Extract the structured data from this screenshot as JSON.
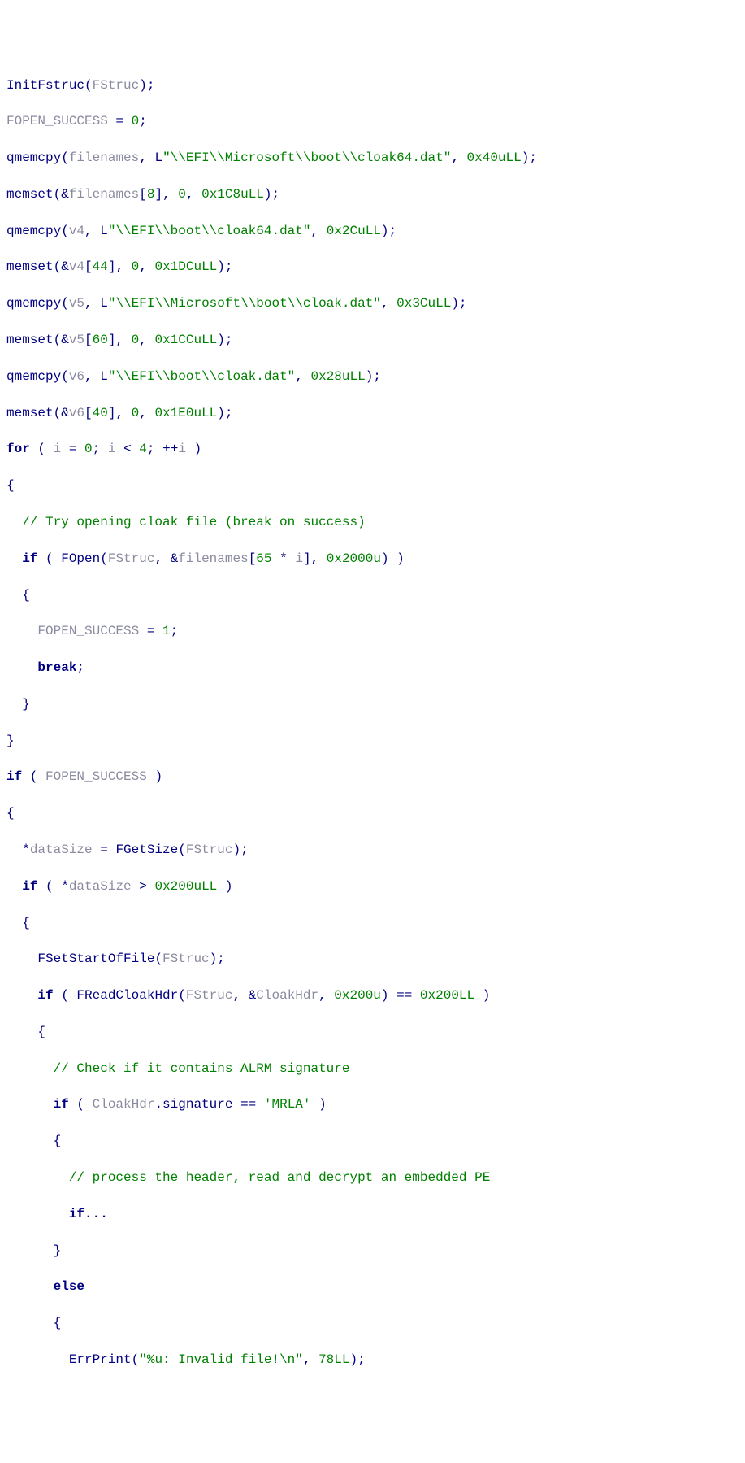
{
  "code": {
    "l1": {
      "fn": "InitFstruc",
      "arg": "FStruc"
    },
    "l2": {
      "lhs": "FOPEN_SUCCESS",
      "rhs": "0"
    },
    "l3": {
      "fn": "qmemcpy",
      "a1": "filenames",
      "prefix": "L",
      "str": "\"\\\\EFI\\\\Microsoft\\\\boot\\\\cloak64.dat\"",
      "a3": "0x40uLL"
    },
    "l4": {
      "fn": "memset",
      "pre": "&",
      "a1": "filenames",
      "idx": "8",
      "a2": "0",
      "a3": "0x1C8uLL"
    },
    "l5": {
      "fn": "qmemcpy",
      "a1": "v4",
      "prefix": "L",
      "str": "\"\\\\EFI\\\\boot\\\\cloak64.dat\"",
      "a3": "0x2CuLL"
    },
    "l6": {
      "fn": "memset",
      "pre": "&",
      "a1": "v4",
      "idx": "44",
      "a2": "0",
      "a3": "0x1DCuLL"
    },
    "l7": {
      "fn": "qmemcpy",
      "a1": "v5",
      "prefix": "L",
      "str": "\"\\\\EFI\\\\Microsoft\\\\boot\\\\cloak.dat\"",
      "a3": "0x3CuLL"
    },
    "l8": {
      "fn": "memset",
      "pre": "&",
      "a1": "v5",
      "idx": "60",
      "a2": "0",
      "a3": "0x1CCuLL"
    },
    "l9": {
      "fn": "qmemcpy",
      "a1": "v6",
      "prefix": "L",
      "str": "\"\\\\EFI\\\\boot\\\\cloak.dat\"",
      "a3": "0x28uLL"
    },
    "l10": {
      "fn": "memset",
      "pre": "&",
      "a1": "v6",
      "idx": "40",
      "a2": "0",
      "a3": "0x1E0uLL"
    },
    "l11": {
      "kw": "for",
      "init_l": "i",
      "init_r": "0",
      "cond_l": "i",
      "cond_op": "<",
      "cond_r": "4",
      "iter": "++",
      "iter_v": "i"
    },
    "l12": "{",
    "l13": "// Try opening cloak file (break on success)",
    "l14": {
      "kw": "if",
      "fn": "FOpen",
      "a1": "FStruc",
      "pre": "&",
      "a2": "filenames",
      "idx_l": "65",
      "idx_op": "*",
      "idx_r": "i",
      "a3": "0x2000u"
    },
    "l15": "{",
    "l16": {
      "lhs": "FOPEN_SUCCESS",
      "rhs": "1"
    },
    "l17": "break",
    "l18": "}",
    "l19": "}",
    "l20": {
      "kw": "if",
      "cond": "FOPEN_SUCCESS"
    },
    "l21": "{",
    "l22": {
      "lhs_pre": "*",
      "lhs": "dataSize",
      "fn": "FGetSize",
      "a1": "FStruc"
    },
    "l23": {
      "kw": "if",
      "lhs_pre": "*",
      "lhs": "dataSize",
      "op": ">",
      "rhs": "0x200uLL"
    },
    "l24": "{",
    "l25": {
      "fn": "FSetStartOfFile",
      "a1": "FStruc"
    },
    "l26": {
      "kw": "if",
      "fn": "FReadCloakHdr",
      "a1": "FStruc",
      "pre": "&",
      "a2": "CloakHdr",
      "a3": "0x200u",
      "op": "==",
      "rhs": "0x200LL"
    },
    "l27": "{",
    "l28": "// Check if it contains ALRM signature",
    "l29": {
      "kw": "if",
      "obj": "CloakHdr",
      "mem": "signature",
      "op": "==",
      "rhs": "'MRLA'"
    },
    "l30": "{",
    "l31": "// process the header, read and decrypt an embedded PE",
    "l32": "if...",
    "l33": "}",
    "l34": "else",
    "l35": "{",
    "l36": {
      "fn": "ErrPrint",
      "str": "\"%u: Invalid file!\\n\"",
      "a2": "78LL"
    }
  }
}
